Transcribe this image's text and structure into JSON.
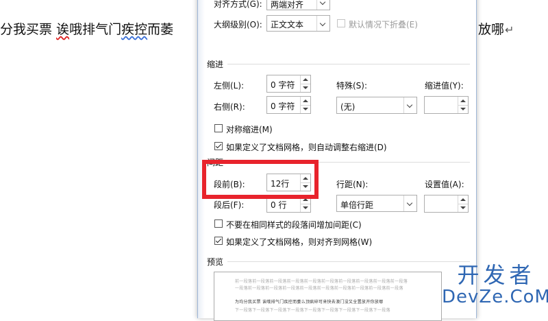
{
  "document": {
    "left_text_a": "分我买票 ",
    "left_text_b": "诶",
    "left_text_c": "哦排气门",
    "left_text_d": "疾控",
    "left_text_e": "而萎",
    "right_text": "放哪",
    "pilcrow": "↵"
  },
  "dialog": {
    "alignment_label": "对齐方式(G):",
    "alignment_value": "两端对齐",
    "outline_label": "大纲级别(O):",
    "outline_value": "正文文本",
    "collapse_label": "默认情况下折叠(E)",
    "indent_section": "缩进",
    "left_label": "左侧(L):",
    "left_value": "0 字符",
    "right_label": "右侧(R):",
    "right_value": "0 字符",
    "special_label": "特殊(S):",
    "special_value": "(无)",
    "indent_by_label": "缩进值(Y):",
    "mirror_label": "对称缩进(M)",
    "auto_adjust_label": "如果定义了文档网格，则自动调整右缩进(D)",
    "spacing_section": "间距",
    "before_label": "段前(B):",
    "before_value": "12行",
    "after_label": "段后(F):",
    "after_value": "0 行",
    "line_spacing_label": "行距(N):",
    "line_spacing_value": "单倍行距",
    "at_label": "设置值(A):",
    "no_space_label": "不要在相同样式的段落间增加间距(C)",
    "snap_grid_label": "如果定义了文档网格，则对齐到网格(W)",
    "preview_section": "预览",
    "preview_lines": [
      "前一段落前一段落前一段落前一段落前一段落前一段落前一段落前一段落前一段落前一段落",
      "一段落前一段落前一段落前一段落前一段落前一段落前一段落前一段落前一段落前一段落",
      "为均分我买票 诶哦排气门疾控而萎么顶疯碎可来快去澳门没又全置放开你放哪",
      "下一段落下一段落下一段落下一段落下一段落下一段落下一段落下一段落下一段落"
    ]
  },
  "watermark": {
    "top": "开发者",
    "bottom": "DevZe.CoM"
  },
  "colors": {
    "highlight": "#e8232c",
    "watermark": "#2f67b3"
  }
}
